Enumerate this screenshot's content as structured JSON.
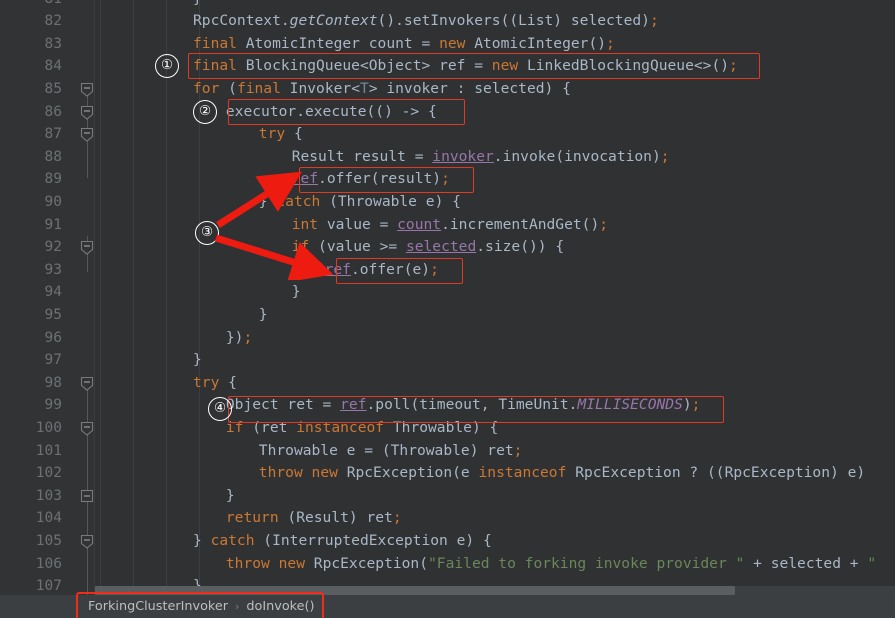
{
  "editor": {
    "theme_bg": "#2f3133",
    "gutter_bg": "#313335",
    "first_line_number": 81,
    "lines": [
      {
        "num": "81",
        "indent": 0,
        "text": "}"
      },
      {
        "num": "82",
        "indent": 0,
        "text": "RpcContext.getContext().setInvokers((List) selected);"
      },
      {
        "num": "83",
        "indent": 0,
        "text": "final AtomicInteger count = new AtomicInteger();"
      },
      {
        "num": "84",
        "indent": 0,
        "text": "final BlockingQueue<Object> ref = new LinkedBlockingQueue<>();"
      },
      {
        "num": "85",
        "indent": 0,
        "text": "for (final Invoker<T> invoker : selected) {"
      },
      {
        "num": "86",
        "indent": 1,
        "text": "executor.execute(() -> {"
      },
      {
        "num": "87",
        "indent": 2,
        "text": "try {"
      },
      {
        "num": "88",
        "indent": 3,
        "text": "Result result = invoker.invoke(invocation);"
      },
      {
        "num": "89",
        "indent": 3,
        "text": "ref.offer(result);"
      },
      {
        "num": "90",
        "indent": 2,
        "text": "} catch (Throwable e) {"
      },
      {
        "num": "91",
        "indent": 3,
        "text": "int value = count.incrementAndGet();"
      },
      {
        "num": "92",
        "indent": 3,
        "text": "if (value >= selected.size()) {"
      },
      {
        "num": "93",
        "indent": 4,
        "text": "ref.offer(e);"
      },
      {
        "num": "94",
        "indent": 3,
        "text": "}"
      },
      {
        "num": "95",
        "indent": 2,
        "text": "}"
      },
      {
        "num": "96",
        "indent": 1,
        "text": "});"
      },
      {
        "num": "97",
        "indent": 0,
        "text": "}"
      },
      {
        "num": "98",
        "indent": 0,
        "text": "try {"
      },
      {
        "num": "99",
        "indent": 1,
        "text": "Object ret = ref.poll(timeout, TimeUnit.MILLISECONDS);"
      },
      {
        "num": "100",
        "indent": 1,
        "text": "if (ret instanceof Throwable) {"
      },
      {
        "num": "101",
        "indent": 2,
        "text": "Throwable e = (Throwable) ret;"
      },
      {
        "num": "102",
        "indent": 2,
        "text": "throw new RpcException(e instanceof RpcException ? ((RpcException) e)"
      },
      {
        "num": "103",
        "indent": 1,
        "text": "}"
      },
      {
        "num": "104",
        "indent": 1,
        "text": "return (Result) ret;"
      },
      {
        "num": "105",
        "indent": 0,
        "text": "} catch (InterruptedException e) {"
      },
      {
        "num": "106",
        "indent": 1,
        "text": "throw new RpcException(\"Failed to forking invoke provider \" + selected + \""
      },
      {
        "num": "107",
        "indent": 0,
        "text": "}"
      }
    ],
    "fold_markers": [
      {
        "line": "85",
        "type": "collapse-down"
      },
      {
        "line": "86",
        "type": "collapse-down"
      },
      {
        "line": "87",
        "type": "collapse-down"
      },
      {
        "line": "92",
        "type": "collapse-down"
      },
      {
        "line": "98",
        "type": "collapse-down"
      },
      {
        "line": "100",
        "type": "collapse-down"
      },
      {
        "line": "103",
        "type": "collapse-square"
      },
      {
        "line": "105",
        "type": "collapse-down"
      }
    ]
  },
  "annotations": {
    "accent_color": "#e03a24",
    "markers": [
      {
        "label": "①",
        "target_line": "84"
      },
      {
        "label": "②",
        "target_line": "86"
      },
      {
        "label": "③",
        "target_lines": "89, 93"
      },
      {
        "label": "④",
        "target_line": "99"
      }
    ],
    "highlight_boxes": [
      {
        "line": "84",
        "code": "final BlockingQueue<Object> ref = new LinkedBlockingQueue<>();"
      },
      {
        "line": "86",
        "code": "executor.execute(() -> {"
      },
      {
        "line": "89",
        "code": "ref.offer(result);"
      },
      {
        "line": "93",
        "code": "ref.offer(e);"
      },
      {
        "line": "99",
        "code": "Object ret = ref.poll(timeout, TimeUnit.MILLISECONDS);"
      },
      {
        "line": "breadcrumb",
        "code": "ForkingClusterInvoker > doInvoke()"
      }
    ]
  },
  "breadcrumb": {
    "class_name": "ForkingClusterInvoker",
    "separator": "›",
    "method_name": "doInvoke()"
  },
  "scrollbar": {
    "orientation": "horizontal",
    "position": "bottom"
  }
}
